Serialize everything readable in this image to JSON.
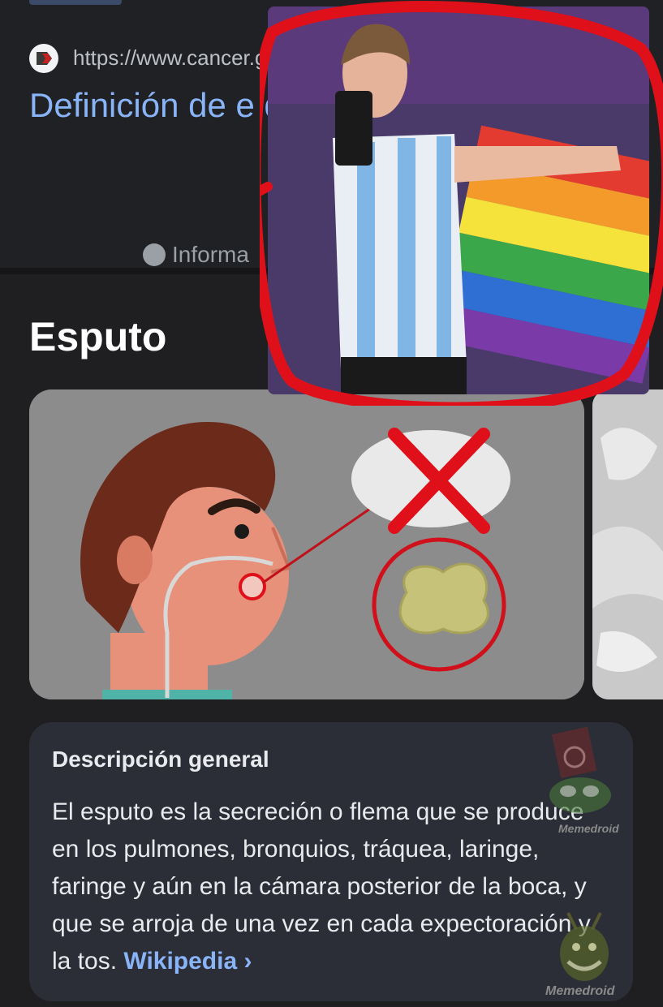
{
  "result": {
    "url": "https://www.cancer.go",
    "title": "Definición de e de cáncer del",
    "info_label": "Informa"
  },
  "section": {
    "heading": "Esputo"
  },
  "description": {
    "title": "Descripción general",
    "body": "El esputo es la secreción o flema que se produce en los pulmones, bronquios, tráquea, laringe, faringe y aún en la cámara posterior de la boca, y que se arroja de una vez en cada expectoración y la tos.",
    "source_label": "Wikipedia",
    "source_chevron": "›"
  },
  "watermarks": {
    "text": "Memedroid"
  },
  "colors": {
    "link": "#8ab4f8",
    "background": "#202124",
    "card": "#2b2e36",
    "annotation_red": "#e0101a"
  }
}
